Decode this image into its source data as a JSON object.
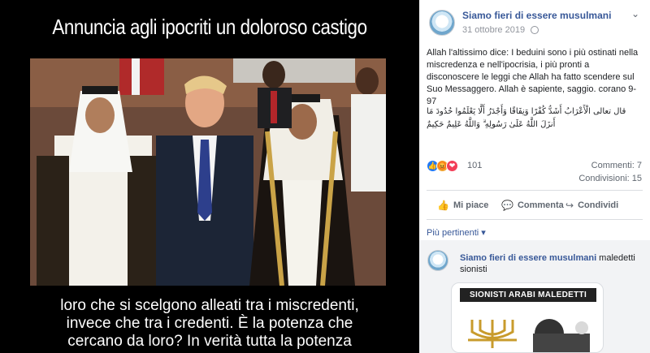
{
  "media": {
    "title": "Annuncia agli ipocriti un doloroso castigo",
    "caption_lines": [
      "loro che si scelgono alleati tra i miscredenti,",
      "invece che tra i credenti. È la potenza che",
      "cercano da loro? In verità tutta la potenza"
    ]
  },
  "post": {
    "page_name": "Siamo fieri di essere musulmani",
    "date": "31 ottobre 2019",
    "text": "Allah l'altissimo dice: I beduini sono i più ostinati nella miscredenza e nell'ipocrisia, i più pronti a disconoscere le leggi che Allah ha fatto scendere sul Suo Messaggero. Allah è sapiente, saggio. corano 9-97",
    "arabic": "قال تعالى الْأَعْرَابُ أَشَدُّ كُفْرًا وَنِفَاقًا وَأَجْدَرُ أَلَّا يَعْلَمُوا حُدُودَ مَا أَنزَلَ اللَّهُ عَلَىٰ رَسُولِهِ ۗ وَاللَّهُ عَلِيمٌ حَكِيمٌ",
    "reaction_count": "101",
    "comments_label": "Commenti: 7",
    "shares_label": "Condivisioni: 15"
  },
  "actions": {
    "like": "Mi piace",
    "comment": "Commenta",
    "share": "Condividi"
  },
  "relevant_label": "Più pertinenti",
  "comment": {
    "author": "Siamo fieri di essere musulmani",
    "text": " maledetti sionisti",
    "sticker_banner": "SIONISTI ARABI MALEDETTI"
  },
  "colors": {
    "link": "#385898",
    "like_blue": "#2078f4",
    "angry": "#f0a12c",
    "love": "#f33e58"
  }
}
